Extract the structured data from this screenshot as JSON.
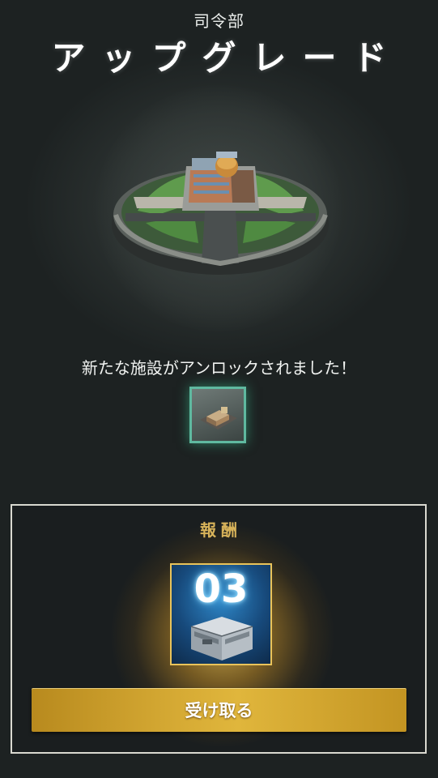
{
  "header": {
    "subtitle": "司令部",
    "title": "アップグレード"
  },
  "building": {
    "icon": "headquarters-building-icon"
  },
  "unlock": {
    "message": "新たな施設がアンロックされました！",
    "facility_icon": "facility-building-icon",
    "tile_border_color": "#5fb9a0"
  },
  "reward": {
    "title": "報酬",
    "count": "03",
    "item_icon": "supply-crate-icon",
    "accent_color": "#d8b35a",
    "claim_label": "受け取る"
  }
}
